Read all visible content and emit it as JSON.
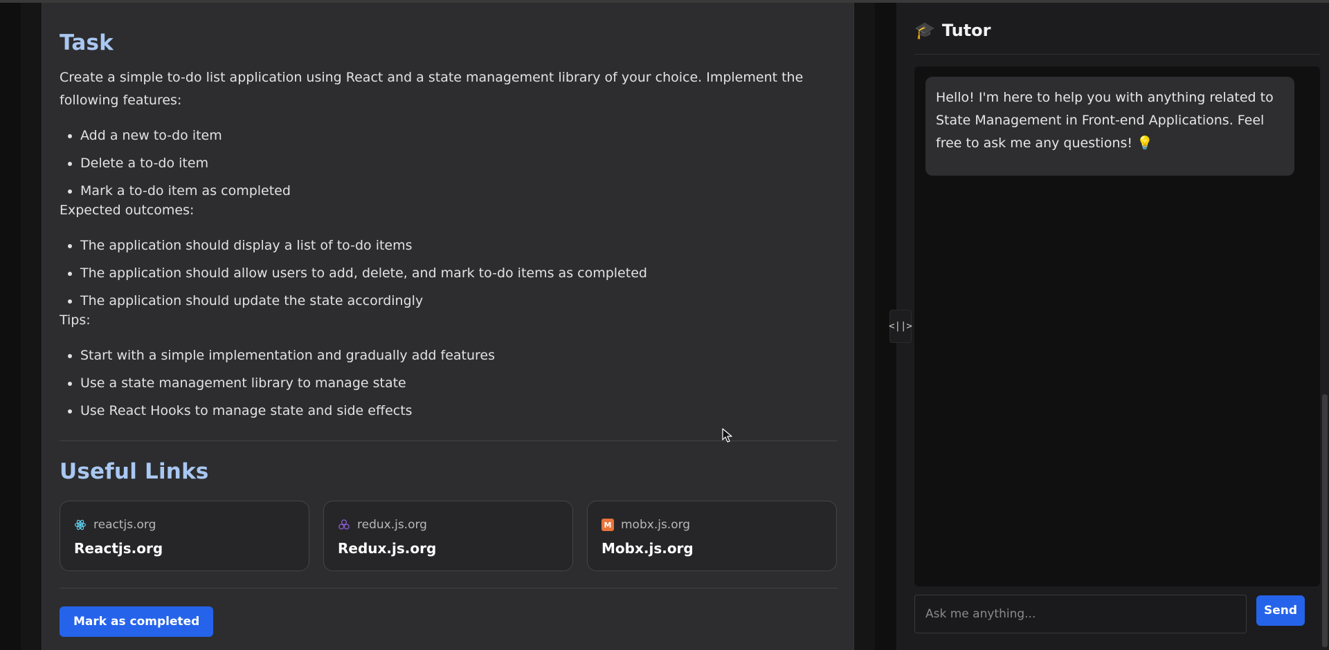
{
  "task": {
    "heading": "Task",
    "intro": "Create a simple to-do list application using React and a state management library of your choice. Implement the following features:",
    "features": [
      "Add a new to-do item",
      "Delete a to-do item",
      "Mark a to-do item as completed"
    ],
    "outcomes_heading": "Expected outcomes:",
    "outcomes": [
      "The application should display a list of to-do items",
      "The application should allow users to add, delete, and mark to-do items as completed",
      "The application should update the state accordingly"
    ],
    "tips_heading": "Tips:",
    "tips": [
      "Start with a simple implementation and gradually add features",
      "Use a state management library to manage state",
      "Use React Hooks to manage state and side effects"
    ]
  },
  "links": {
    "heading": "Useful Links",
    "cards": [
      {
        "host": "reactjs.org",
        "title": "Reactjs.org",
        "icon": "react-icon"
      },
      {
        "host": "redux.js.org",
        "title": "Redux.js.org",
        "icon": "redux-icon"
      },
      {
        "host": "mobx.js.org",
        "title": "Mobx.js.org",
        "icon": "mobx-icon"
      }
    ]
  },
  "actions": {
    "mark_completed": "Mark as completed"
  },
  "splitter": {
    "label": "<||>"
  },
  "tutor": {
    "emoji": "🎓",
    "title": "Tutor",
    "welcome": "Hello! I'm here to help you with anything related to State Management in Front-end Applications. Feel free to ask me any questions! 💡",
    "input_placeholder": "Ask me anything...",
    "send_label": "Send"
  },
  "colors": {
    "accent": "#2563eb",
    "heading": "#a9c8f2",
    "panel": "#2d2d2f",
    "chat_bg": "#101010"
  }
}
